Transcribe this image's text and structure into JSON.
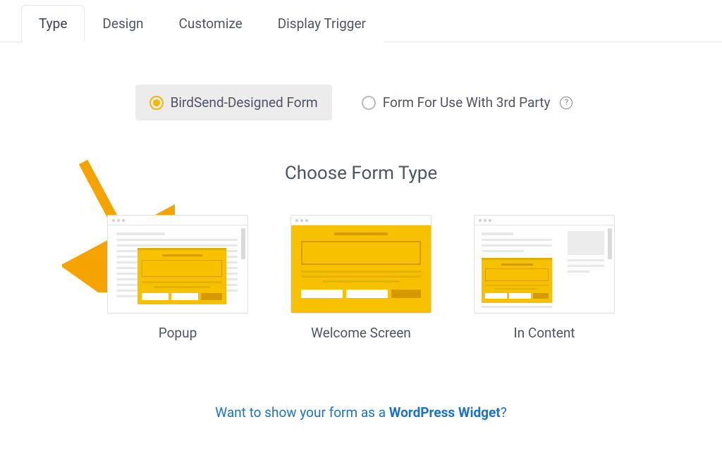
{
  "tabs": {
    "type": "Type",
    "design": "Design",
    "customize": "Customize",
    "display_trigger": "Display Trigger"
  },
  "form_source": {
    "birdsend": "BirdSend-Designed Form",
    "third_party": "Form For Use With 3rd Party"
  },
  "heading": "Choose Form Type",
  "form_types": {
    "popup": "Popup",
    "welcome": "Welcome Screen",
    "in_content": "In Content"
  },
  "footer": {
    "prefix": "Want to show your form as a ",
    "link": "WordPress Widget",
    "suffix": "?"
  }
}
